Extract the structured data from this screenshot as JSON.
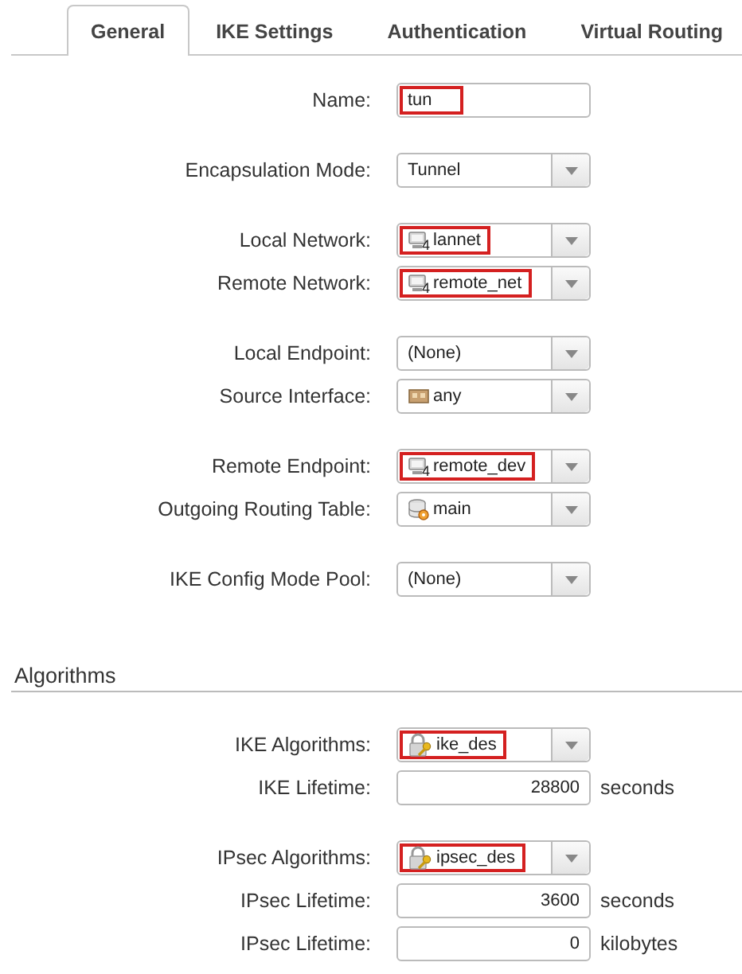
{
  "tabs": [
    {
      "label": "General",
      "selected": true
    },
    {
      "label": "IKE Settings",
      "selected": false
    },
    {
      "label": "Authentication",
      "selected": false
    },
    {
      "label": "Virtual Routing",
      "selected": false
    }
  ],
  "sections": [
    {
      "groups": [
        {
          "rows": [
            {
              "label": "Name:",
              "kind": "text",
              "value": "tun",
              "highlighted": true
            }
          ]
        },
        {
          "rows": [
            {
              "label": "Encapsulation Mode:",
              "kind": "select",
              "value": "Tunnel",
              "highlighted": false
            }
          ]
        },
        {
          "rows": [
            {
              "label": "Local Network:",
              "kind": "network_select",
              "badge": "4",
              "value": "lannet",
              "highlighted": true
            },
            {
              "label": "Remote Network:",
              "kind": "network_select",
              "badge": "4",
              "value": "remote_net",
              "highlighted": true
            }
          ]
        },
        {
          "rows": [
            {
              "label": "Local Endpoint:",
              "kind": "select",
              "value": "(None)",
              "highlighted": false
            },
            {
              "label": "Source Interface:",
              "kind": "interface_select",
              "value": "any",
              "highlighted": false
            }
          ]
        },
        {
          "rows": [
            {
              "label": "Remote Endpoint:",
              "kind": "network_select",
              "badge": "4",
              "value": "remote_dev",
              "highlighted": true
            },
            {
              "label": "Outgoing Routing Table:",
              "kind": "routing_select",
              "value": "main",
              "highlighted": false
            }
          ]
        },
        {
          "rows": [
            {
              "label": "IKE Config Mode Pool:",
              "kind": "select",
              "value": "(None)",
              "highlighted": false
            }
          ]
        }
      ]
    },
    {
      "title": "Algorithms",
      "groups": [
        {
          "rows": [
            {
              "label": "IKE Algorithms:",
              "kind": "key_select",
              "value": "ike_des",
              "highlighted": true
            },
            {
              "label": "IKE Lifetime:",
              "kind": "number",
              "value": "28800",
              "unit": "seconds",
              "highlighted": false
            }
          ]
        },
        {
          "rows": [
            {
              "label": "IPsec Algorithms:",
              "kind": "key_select",
              "value": "ipsec_des",
              "highlighted": true
            },
            {
              "label": "IPsec Lifetime:",
              "kind": "number",
              "value": "3600",
              "unit": "seconds",
              "highlighted": false
            },
            {
              "label": "IPsec Lifetime:",
              "kind": "number",
              "value": "0",
              "unit": "kilobytes",
              "highlighted": false
            }
          ]
        }
      ]
    }
  ]
}
